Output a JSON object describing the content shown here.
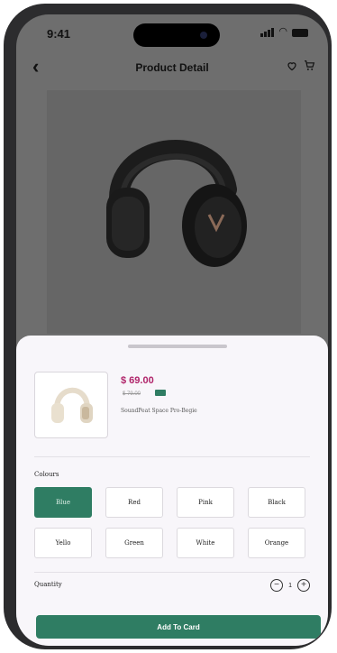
{
  "status_bar": {
    "time": "9:41"
  },
  "app_bar": {
    "title": "Product Detail",
    "back_icon": "chevron-left-icon",
    "wishlist_icon": "heart-icon",
    "cart_icon": "cart-icon"
  },
  "product": {
    "price": "$ 69.00",
    "old_price": "$ 79.00",
    "name": "SoundPeat Space Pro-Begie"
  },
  "colours": {
    "label": "Colours",
    "selected": "Blue",
    "options": [
      "Blue",
      "Red",
      "Pink",
      "Black",
      "Yello",
      "Green",
      "White",
      "Orange"
    ]
  },
  "quantity": {
    "label": "Quantity",
    "value": "1"
  },
  "actions": {
    "add_label": "Add To Card"
  },
  "theme": {
    "accent": "#2f7d63",
    "price_color": "#b0246a",
    "overlay": "#6e6e6e",
    "sheet": "#f8f6fa"
  }
}
